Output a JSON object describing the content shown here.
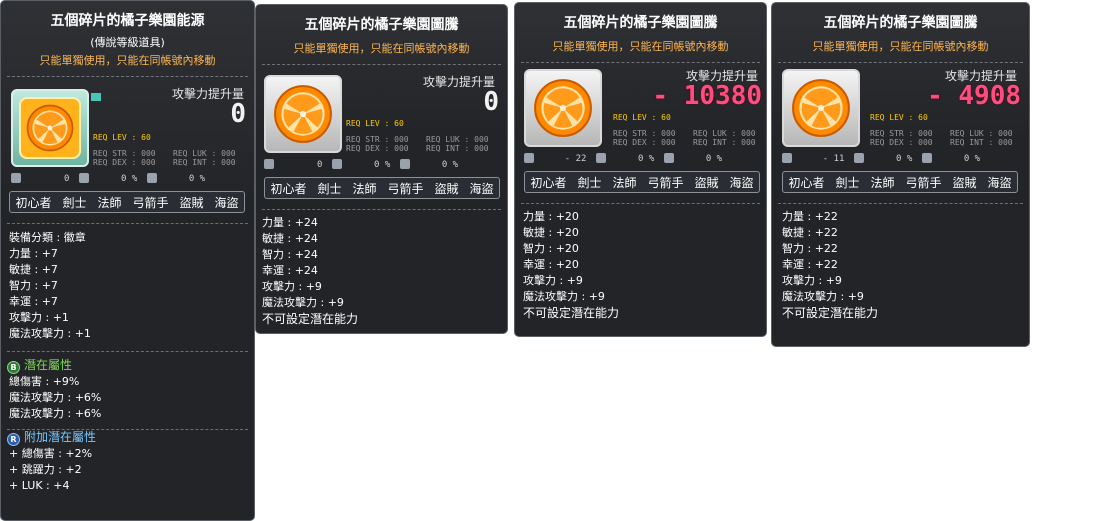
{
  "panels": [
    {
      "title": "五個碎片的橘子樂園能源",
      "subtitle": "(傳說等級道具)",
      "notice": "只能單獨使用，只能在同帳號內移動",
      "attack_label": "攻擊力提升量",
      "attack_value": "0",
      "req_lev": "REQ LEV :  60",
      "req_str": "REQ STR : 000",
      "req_dex": "REQ DEX : 000",
      "req_luk": "REQ LUK : 000",
      "req_int": "REQ INT : 000",
      "row_left": "0",
      "row_mid": "0 %",
      "row_right": "0 %",
      "jobs": [
        "初心者",
        "劍士",
        "法師",
        "弓箭手",
        "盜賊",
        "海盜"
      ],
      "stats": [
        "裝備分類 : 徽章",
        "力量 : +7",
        "敏捷 : +7",
        "智力 : +7",
        "幸運 : +7",
        "攻擊力 : +1",
        "魔法攻擊力 : +1"
      ],
      "potential_title": "潛在屬性",
      "potential": [
        "總傷害 : +9%",
        "魔法攻擊力 : +6%",
        "魔法攻擊力 : +6%"
      ],
      "additional_title": "附加潛在屬性",
      "additional": [
        "+ 總傷害 : +2%",
        "+ 跳躍力 : +2",
        "+ LUK : +4"
      ]
    },
    {
      "title": "五個碎片的橘子樂園圖騰",
      "notice": "只能單獨使用，只能在同帳號內移動",
      "attack_label": "攻擊力提升量",
      "attack_value": "0",
      "req_lev": "REQ LEV :  60",
      "req_str": "REQ STR : 000",
      "req_dex": "REQ DEX : 000",
      "req_luk": "REQ LUK : 000",
      "req_int": "REQ INT : 000",
      "row_left": "0",
      "row_mid": "0 %",
      "row_right": "0 %",
      "jobs": [
        "初心者",
        "劍士",
        "法師",
        "弓箭手",
        "盜賊",
        "海盜"
      ],
      "stats": [
        "力量 : +24",
        "敏捷 : +24",
        "智力 : +24",
        "幸運 : +24",
        "攻擊力 : +9",
        "魔法攻擊力 : +9",
        "不可設定潛在能力"
      ]
    },
    {
      "title": "五個碎片的橘子樂園圖騰",
      "notice": "只能單獨使用，只能在同帳號內移動",
      "attack_label": "攻擊力提升量",
      "attack_value": "- 10380",
      "req_lev": "REQ LEV :  60",
      "req_str": "REQ STR : 000",
      "req_dex": "REQ DEX : 000",
      "req_luk": "REQ LUK : 000",
      "req_int": "REQ INT : 000",
      "row_left": "- 22",
      "row_mid": "0 %",
      "row_right": "0 %",
      "jobs": [
        "初心者",
        "劍士",
        "法師",
        "弓箭手",
        "盜賊",
        "海盜"
      ],
      "stats": [
        "力量 : +20",
        "敏捷 : +20",
        "智力 : +20",
        "幸運 : +20",
        "攻擊力 : +9",
        "魔法攻擊力 : +9",
        "不可設定潛在能力"
      ]
    },
    {
      "title": "五個碎片的橘子樂園圖騰",
      "notice": "只能單獨使用，只能在同帳號內移動",
      "attack_label": "攻擊力提升量",
      "attack_value": "- 4908",
      "req_lev": "REQ LEV :  60",
      "req_str": "REQ STR : 000",
      "req_dex": "REQ DEX : 000",
      "req_luk": "REQ LUK : 000",
      "req_int": "REQ INT : 000",
      "row_left": "- 11",
      "row_mid": "0 %",
      "row_right": "0 %",
      "jobs": [
        "初心者",
        "劍士",
        "法師",
        "弓箭手",
        "盜賊",
        "海盜"
      ],
      "stats": [
        "力量 : +22",
        "敏捷 : +22",
        "智力 : +22",
        "幸運 : +22",
        "攻擊力 : +9",
        "魔法攻擊力 : +9",
        "不可設定潛在能力"
      ]
    }
  ],
  "icons": {
    "item_icon": "orange-slice-icon",
    "row_icons": [
      "weapon-icon",
      "attack-up-icon",
      "shield-icon"
    ],
    "potential_badge": "potential-badge-icon",
    "additional_badge": "additional-potential-badge-icon"
  },
  "colors": {
    "panel_bg": "#16181c",
    "notice": "#ffb34a",
    "req_lev": "#ffcc00",
    "negative_attack": "#ff4d7e",
    "potential_title": "#7ed957",
    "additional_title": "#78c8ff"
  }
}
